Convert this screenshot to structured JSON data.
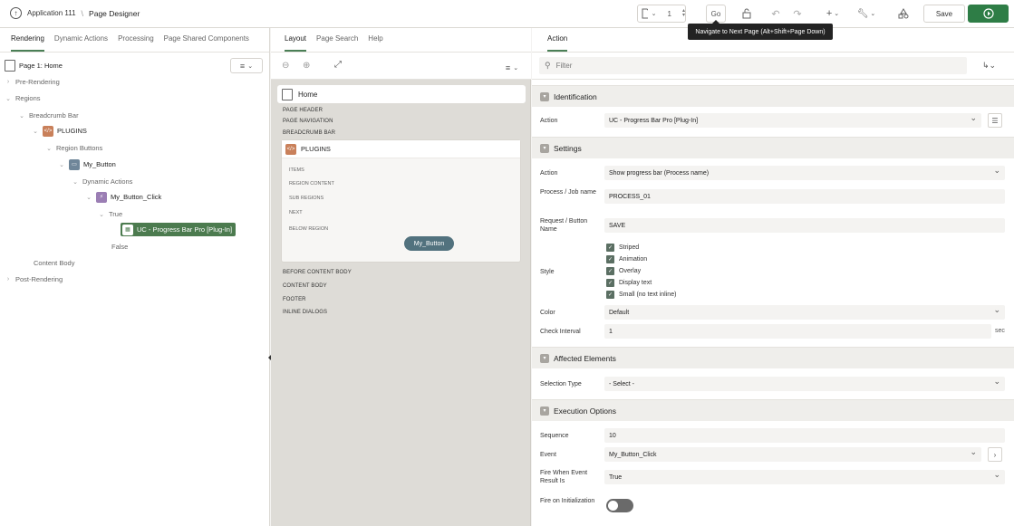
{
  "header": {
    "app_label": "Application 111",
    "separator": "\\",
    "title": "Page Designer",
    "page_number": "1",
    "go_label": "Go",
    "save_label": "Save",
    "tooltip": "Navigate to Next Page (Alt+Shift+Page Down)"
  },
  "left": {
    "tabs": [
      "Rendering",
      "Dynamic Actions",
      "Processing",
      "Page Shared Components"
    ],
    "tree": [
      {
        "label": "Page 1: Home"
      },
      {
        "label": "Pre-Rendering"
      },
      {
        "label": "Regions"
      },
      {
        "label": "Breadcrumb Bar"
      },
      {
        "label": "PLUGINS"
      },
      {
        "label": "Region Buttons"
      },
      {
        "label": "My_Button"
      },
      {
        "label": "Dynamic Actions"
      },
      {
        "label": "My_Button_Click"
      },
      {
        "label": "True"
      },
      {
        "label": "UC - Progress Bar Pro [Plug-In]"
      },
      {
        "label": "False"
      },
      {
        "label": "Content Body"
      },
      {
        "label": "Post-Rendering"
      }
    ]
  },
  "mid": {
    "tabs": [
      "Layout",
      "Page Search",
      "Help"
    ],
    "page_title": "Home",
    "positions_top": [
      "PAGE HEADER",
      "PAGE NAVIGATION",
      "BREADCRUMB BAR"
    ],
    "region_title": "PLUGINS",
    "region_positions": [
      "ITEMS",
      "REGION CONTENT",
      "SUB REGIONS",
      "NEXT",
      "BELOW REGION"
    ],
    "button_label": "My_Button",
    "positions_bottom": [
      "BEFORE CONTENT BODY",
      "CONTENT BODY",
      "FOOTER",
      "INLINE DIALOGS"
    ]
  },
  "right": {
    "tab": "Action",
    "filter_placeholder": "Filter",
    "identification": {
      "title": "Identification",
      "action_label": "Action",
      "action_value": "UC - Progress Bar Pro [Plug-In]"
    },
    "settings": {
      "title": "Settings",
      "action_label": "Action",
      "action_value": "Show progress bar (Process name)",
      "process_label": "Process / Job name",
      "process_value": "PROCESS_01",
      "request_label": "Request / Button Name",
      "request_value": "SAVE",
      "style_label": "Style",
      "style_options": [
        "Striped",
        "Animation",
        "Overlay",
        "Display text",
        "Small (no text inline)"
      ],
      "color_label": "Color",
      "color_value": "Default",
      "interval_label": "Check Interval",
      "interval_value": "1",
      "interval_suffix": "sec"
    },
    "affected": {
      "title": "Affected Elements",
      "selection_label": "Selection Type",
      "selection_value": "- Select -"
    },
    "execution": {
      "title": "Execution Options",
      "sequence_label": "Sequence",
      "sequence_value": "10",
      "event_label": "Event",
      "event_value": "My_Button_Click",
      "fire_result_label": "Fire When Event Result Is",
      "fire_result_value": "True",
      "fire_init_label": "Fire on Initialization"
    }
  },
  "colors": {
    "accent_green": "#4c7b4f",
    "run_button": "#2e7d46",
    "button_pill": "#52727e"
  }
}
